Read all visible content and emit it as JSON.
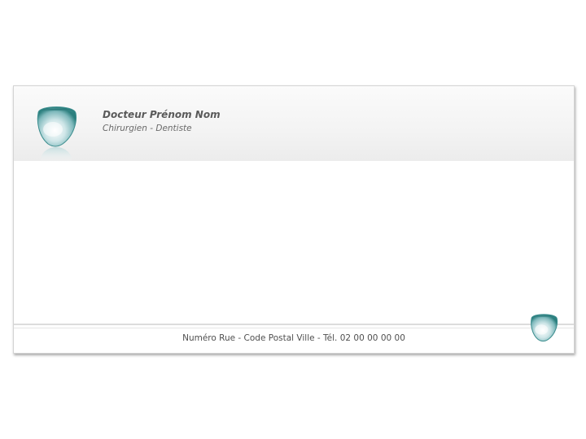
{
  "letterhead": {
    "name": "Docteur Prénom Nom",
    "title": "Chirurgien - Dentiste"
  },
  "footer": {
    "address": "Numéro Rue - Code Postal Ville - Tél. 02 00 00 00 00"
  },
  "icons": {
    "logo": "tooth-drop-icon"
  },
  "colors": {
    "accent": "#2f8f8c",
    "text_dark": "#595959",
    "text_light": "#6a6a6a"
  }
}
